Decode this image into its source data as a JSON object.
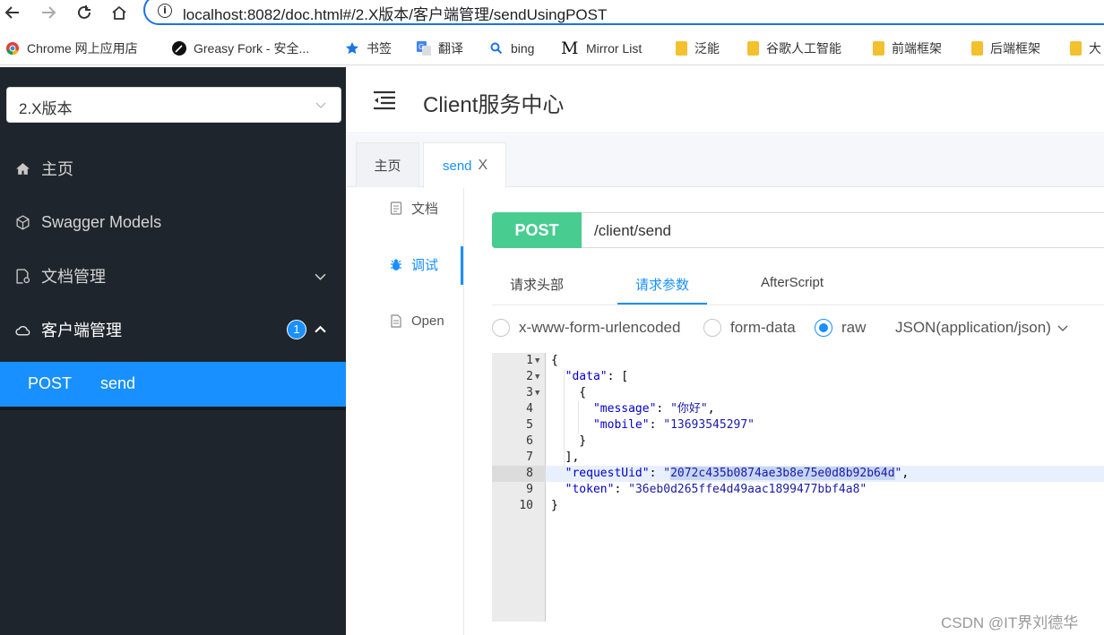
{
  "browser": {
    "url": "localhost:8082/doc.html#/2.X版本/客户端管理/sendUsingPOST",
    "bookmarks": [
      {
        "label": "Chrome 网上应用店",
        "icon": "chrome-webstore-icon"
      },
      {
        "label": "Greasy Fork - 安全...",
        "icon": "greasyfork-icon"
      },
      {
        "label": "书签",
        "icon": "star-icon"
      },
      {
        "label": "翻译",
        "icon": "google-translate-icon"
      },
      {
        "label": "bing",
        "icon": "search-icon"
      },
      {
        "label": "Mirror List",
        "icon": "mirror-m-icon"
      },
      {
        "label": "泛能",
        "icon": "folder-icon"
      },
      {
        "label": "谷歌人工智能",
        "icon": "folder-icon"
      },
      {
        "label": "前端框架",
        "icon": "folder-icon"
      },
      {
        "label": "后端框架",
        "icon": "folder-icon"
      },
      {
        "label": "大",
        "icon": "folder-icon"
      }
    ]
  },
  "sidebar": {
    "version": "2.X版本",
    "menu": {
      "home": "主页",
      "models": "Swagger Models",
      "docs": "文档管理",
      "client": "客户端管理",
      "client_badge": "1"
    },
    "active_item": {
      "method": "POST",
      "path": "send"
    }
  },
  "header": {
    "title": "Client服务中心"
  },
  "tabs": {
    "home": "主页",
    "send": "send",
    "close": "X"
  },
  "leftnav": {
    "doc": "文档",
    "debug": "调试",
    "open": "Open"
  },
  "request": {
    "method": "POST",
    "path": "/client/send",
    "tabs": [
      "请求头部",
      "请求参数",
      "AfterScript"
    ],
    "active_tab": "请求参数",
    "body_types": [
      "x-www-form-urlencoded",
      "form-data",
      "raw"
    ],
    "selected_body_type": "raw",
    "content_type": "JSON(application/json)"
  },
  "editor": {
    "message": "你好",
    "mobile": "13693545297",
    "requestUid": "2072c435b0874ae3b8e75e0d8b92b64d",
    "token": "36eb0d265ffe4d49aac1899477bbf4a8"
  },
  "watermark": "CSDN @IT界刘德华",
  "colors": {
    "accent": "#1890ff",
    "post": "#49cc90",
    "sidebar_bg": "#1f252c"
  }
}
